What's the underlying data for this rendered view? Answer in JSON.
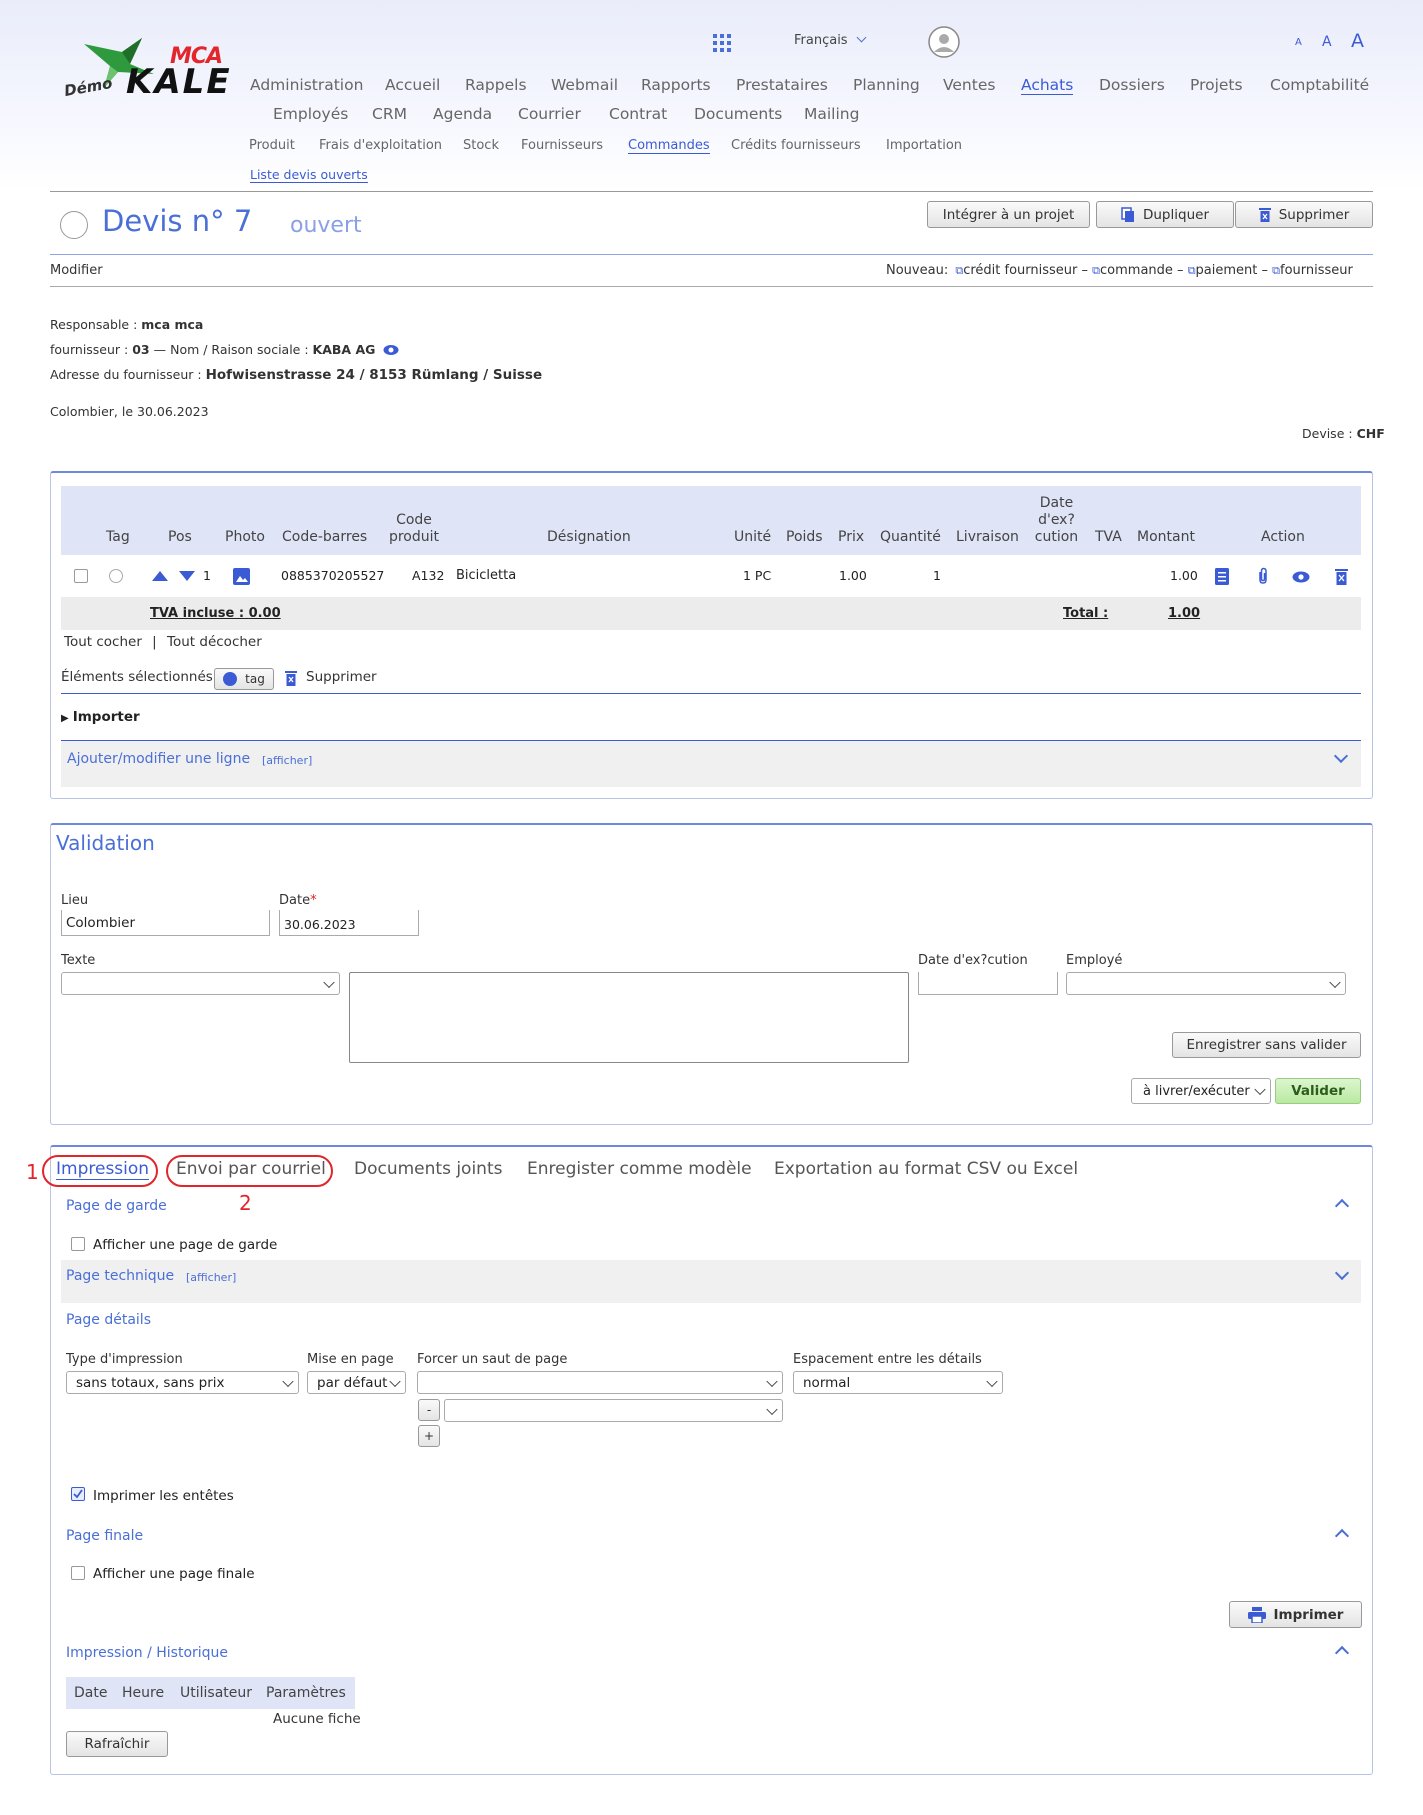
{
  "header": {
    "logo_mca": "MCA",
    "logo_demo": "Démo",
    "logo_kale": "KALE",
    "language": "Français",
    "font_sizes": [
      "A",
      "A",
      "A"
    ]
  },
  "nav": {
    "row1": [
      "Administration",
      "Accueil",
      "Rappels",
      "Webmail",
      "Rapports",
      "Prestataires",
      "Planning",
      "Ventes",
      "Achats",
      "Dossiers",
      "Projets",
      "Comptabilité"
    ],
    "row2": [
      "Employés",
      "CRM",
      "Agenda",
      "Courrier",
      "Contrat",
      "Documents",
      "Mailing"
    ],
    "sub": [
      "Produit",
      "Frais d'exploitation",
      "Stock",
      "Fournisseurs",
      "Commandes",
      "Crédits fournisseurs",
      "Importation"
    ],
    "subsub": "Liste devis ouverts"
  },
  "doc": {
    "title": "Devis n° 7",
    "status": "ouvert",
    "btn_integrate": "Intégrer à un projet",
    "btn_duplicate": "Dupliquer",
    "btn_delete": "Supprimer",
    "modify": "Modifier",
    "new_label": "Nouveau:",
    "new_links": [
      "crédit fournisseur",
      "commande",
      "paiement",
      "fournisseur"
    ],
    "sep": "–",
    "resp_label": "Responsable :",
    "resp_value": "mca mca",
    "supp_label": "fournisseur :",
    "supp_num": "03",
    "supp_dash": "— Nom / Raison sociale :",
    "supp_name": "KABA AG",
    "addr_label": "Adresse du fournisseur :",
    "addr_value": "Hofwisenstrasse 24 / 8153 Rümlang / Suisse",
    "place_date": "Colombier, le 30.06.2023",
    "currency_label": "Devise :",
    "currency_value": "CHF"
  },
  "table": {
    "headers": [
      "Tag",
      "Pos",
      "Photo",
      "Code-barres",
      "Code\nproduit",
      "Désignation",
      "Unité",
      "Poids",
      "Prix",
      "Quantité",
      "Livraison",
      "Date\nd'ex?\ncution",
      "TVA",
      "Montant",
      "Action"
    ],
    "row": {
      "pos": "1",
      "barcode": "0885370205527",
      "code": "A132",
      "designation": "Bicicletta",
      "unit": "1 PC",
      "price": "1.00",
      "qty": "1",
      "amount": "1.00"
    },
    "tva_label": "TVA incluse :",
    "tva_value": "0.00",
    "total_label": "Total :",
    "total_value": "1.00",
    "check_all": "Tout cocher",
    "bar": "|",
    "uncheck_all": "Tout décocher",
    "selected_label": "Éléments sélectionnés:",
    "tag_btn": "tag",
    "sel_delete": "Supprimer",
    "import": "Importer",
    "add_line": "Ajouter/modifier une ligne",
    "show": "[afficher]"
  },
  "validation": {
    "title": "Validation",
    "lieu_label": "Lieu",
    "lieu_value": "Colombier",
    "date_label": "Date",
    "req": "*",
    "date_value": "30.06.2023",
    "texte_label": "Texte",
    "exec_label": "Date d'ex?cution",
    "employee_label": "Employé",
    "save_btn": "Enregistrer sans valider",
    "deliver_select": "à livrer/exécuter",
    "validate_btn": "Valider"
  },
  "tabs": [
    "Impression",
    "Envoi par courriel",
    "Documents joints",
    "Enregister comme modèle",
    "Exportation au format CSV ou Excel"
  ],
  "annotations": [
    "1",
    "2"
  ],
  "print": {
    "cover_title": "Page de garde",
    "cover_check": "Afficher une page de garde",
    "tech_title": "Page technique",
    "tech_show": "[afficher]",
    "details_title": "Page détails",
    "type_label": "Type d'impression",
    "type_value": "sans totaux, sans prix",
    "layout_label": "Mise en page",
    "layout_value": "par défaut",
    "break_label": "Forcer un saut de page",
    "minus": "-",
    "plus": "+",
    "spacing_label": "Espacement entre les détails",
    "spacing_value": "normal",
    "headers_check": "Imprimer les entêtes",
    "final_title": "Page finale",
    "final_check": "Afficher une page finale",
    "print_btn": "Imprimer",
    "history_title": "Impression / Historique",
    "history_headers": [
      "Date",
      "Heure",
      "Utilisateur",
      "Paramètres"
    ],
    "history_empty": "Aucune fiche",
    "refresh_btn": "Rafraîchir"
  }
}
